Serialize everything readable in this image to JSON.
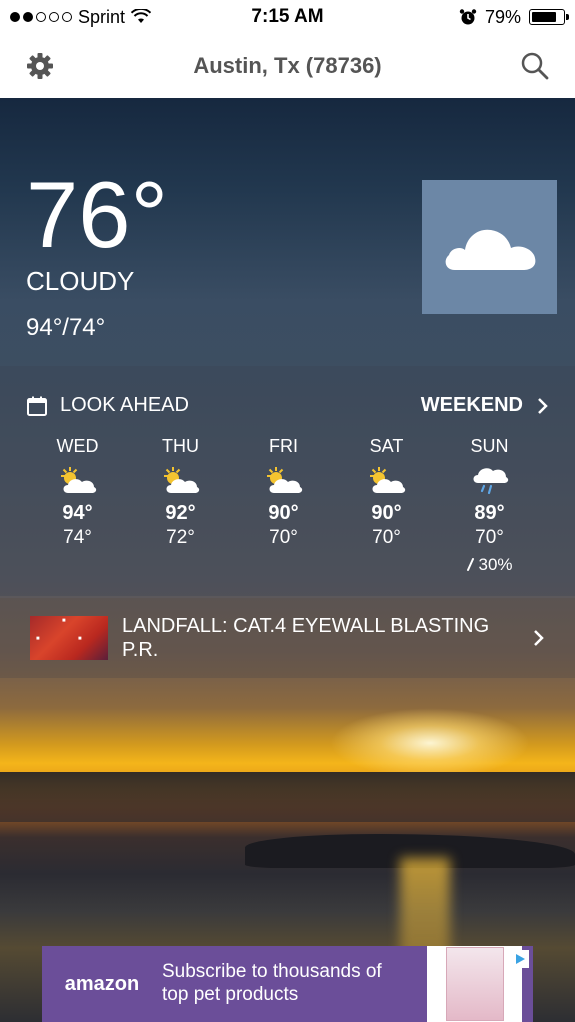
{
  "status_bar": {
    "carrier": "Sprint",
    "time": "7:15 AM",
    "battery": "79%",
    "battery_level": 0.79
  },
  "header": {
    "title": "Austin, Tx (78736)",
    "settings_icon": "gear-icon",
    "search_icon": "search-icon"
  },
  "current": {
    "temperature": "76°",
    "condition": "CLOUDY",
    "hi_lo": "94°/74°",
    "icon": "cloud-icon"
  },
  "look_ahead": {
    "label": "LOOK AHEAD",
    "weekend_label": "WEEKEND",
    "days": [
      {
        "name": "WED",
        "hi": "94°",
        "lo": "74°",
        "icon": "partly-sunny-icon",
        "precip": ""
      },
      {
        "name": "THU",
        "hi": "92°",
        "lo": "72°",
        "icon": "partly-sunny-icon",
        "precip": ""
      },
      {
        "name": "FRI",
        "hi": "90°",
        "lo": "70°",
        "icon": "partly-sunny-icon",
        "precip": ""
      },
      {
        "name": "SAT",
        "hi": "90°",
        "lo": "70°",
        "icon": "partly-sunny-icon",
        "precip": ""
      },
      {
        "name": "SUN",
        "hi": "89°",
        "lo": "70°",
        "icon": "rain-cloud-icon",
        "precip": "30%"
      }
    ]
  },
  "news": {
    "headline": "LANDFALL: CAT.4 EYEWALL BLASTING P.R."
  },
  "ad": {
    "brand": "amazon",
    "text": "Subscribe to thousands of top pet products"
  }
}
